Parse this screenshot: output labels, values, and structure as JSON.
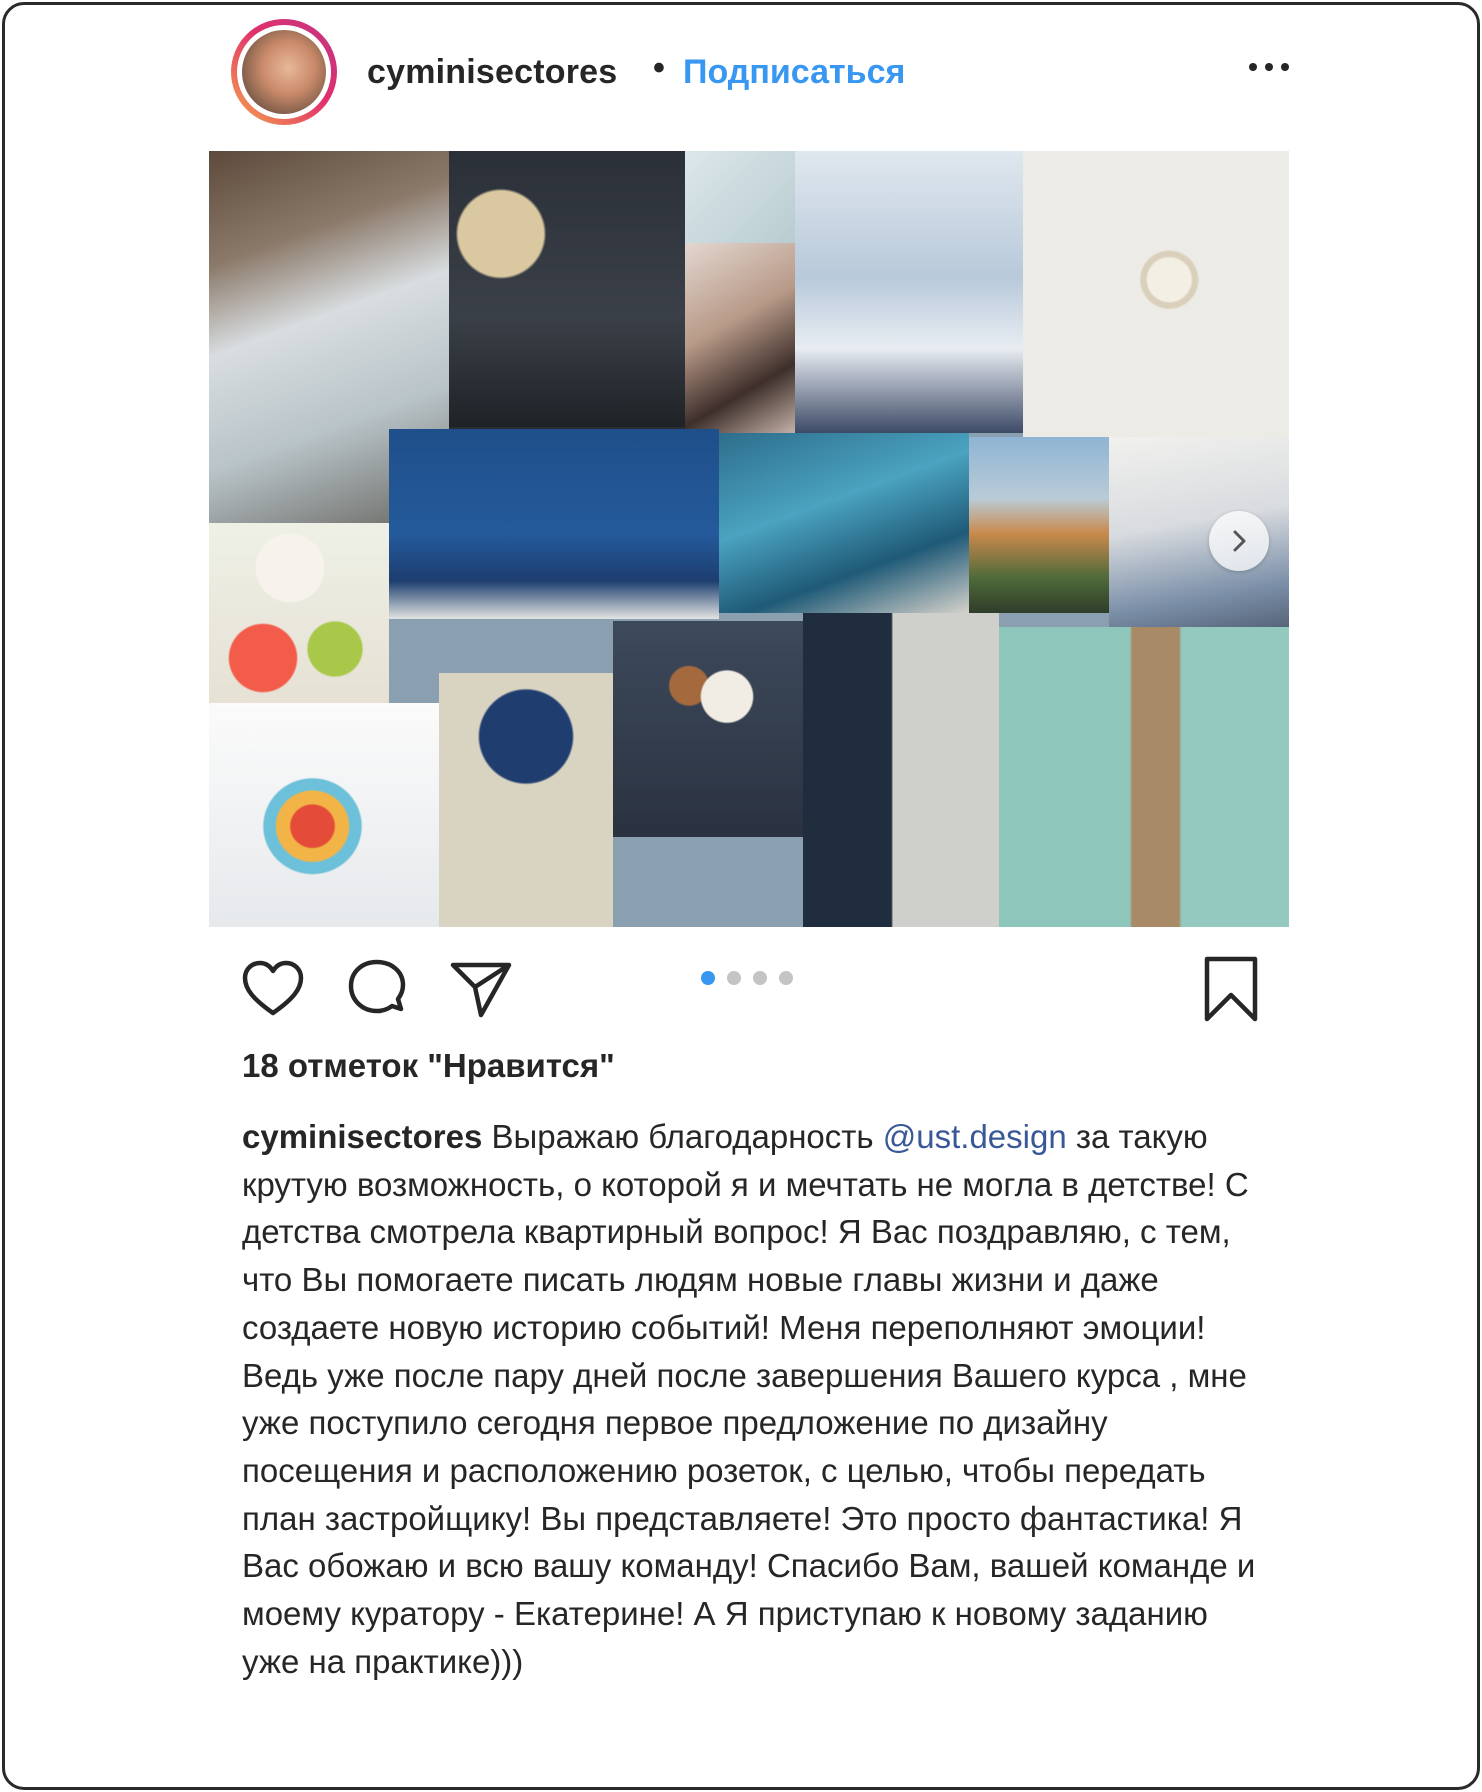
{
  "post": {
    "username": "cyminisectores",
    "separator": "•",
    "follow_label": "Подписаться",
    "more_icon": "more-horizontal-icon",
    "carousel": {
      "position": 1,
      "total": 4,
      "next_icon": "chevron-right-icon"
    },
    "actions": {
      "like_icon": "heart-icon",
      "comment_icon": "comment-icon",
      "share_icon": "paper-plane-icon",
      "save_icon": "bookmark-icon"
    },
    "likes_text": "18 отметок \"Нравится\"",
    "caption": {
      "user": "cyminisectores",
      "text_before": " Выражаю благодарность ",
      "mention": "@ust.design",
      "text_after": " за такую крутую возможность, о которой я и мечтать не могла в детстве! С детства смотрела квартирный вопрос! Я Вас поздравляю, с тем, что Вы помогаете писать людям новые главы жизни и даже создаете новую историю событий! Меня переполняют эмоции! Ведь уже после пару дней после завершения Вашего курса , мне уже поступило сегодня первое предложение по дизайну посещения и расположению розеток, с целью, чтобы передать план застройщику! Вы представляете! Это просто фантастика! Я Вас обожаю и всю вашу команду! Спасибо Вам, вашей команде и моему куратору - Екатерине! А Я приступаю к новому заданию уже на практике)))"
    },
    "colors": {
      "link": "#3897f0",
      "mention": "#385898",
      "text": "#262626",
      "dot_inactive": "#c4c4c4"
    }
  }
}
